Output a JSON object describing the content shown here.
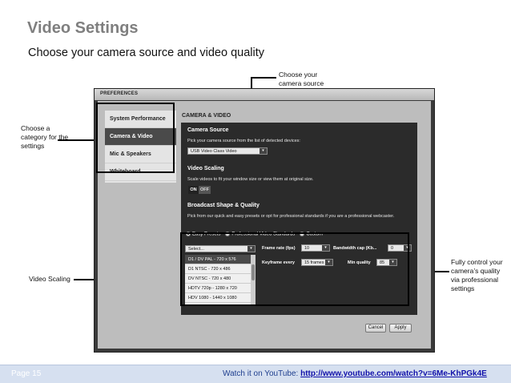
{
  "slide": {
    "title": "Video Settings",
    "subtitle": "Choose your camera source and video quality"
  },
  "callouts": {
    "camera_source": "Choose your camera source",
    "category": "Choose a category for the settings",
    "scaling": "Video Scaling",
    "quality": "Fully control your camera’s quality via professional settings"
  },
  "window": {
    "title": "PREFERENCES",
    "nav": [
      {
        "label": "System Performance",
        "active": false
      },
      {
        "label": "Camera & Video",
        "active": true
      },
      {
        "label": "Mic & Speakers",
        "active": false
      },
      {
        "label": "Whiteboard",
        "active": false
      }
    ],
    "panel_title": "CAMERA & VIDEO",
    "camera_source": {
      "title": "Camera Source",
      "text": "Pick your camera source from the list of detected devices:",
      "selected": "USB Video Class Video"
    },
    "video_scaling": {
      "title": "Video Scaling",
      "text": "Scale videos to fit your window size or view them at original size.",
      "on": "ON",
      "off": "OFF"
    },
    "broadcast": {
      "title": "Broadcast Shape & Quality",
      "text": "Pick from our quick and easy presets or opt for professional standards if you are a professional webcaster.",
      "radios": [
        "Easy Presets",
        "Professional Video Standards",
        "Custom"
      ],
      "select_placeholder": "Select...",
      "presets": [
        "D1 / DV PAL - 720 x 576",
        "D1 NTSC - 720 x 486",
        "DV NTSC - 720 x 480",
        "HDTV 720p - 1280 x 720",
        "HDV 1080 - 1440 x 1080"
      ],
      "frame_rate_label": "Frame rate (fps)",
      "frame_rate_value": "10",
      "bandwidth_label": "Bandwidth cap (Kb...",
      "bandwidth_value": "0",
      "keyframe_label": "Keyframe every",
      "keyframe_value": "15 frames",
      "min_quality_label": "Min quality",
      "min_quality_value": "85"
    },
    "buttons": {
      "cancel": "Cancel",
      "apply": "Apply"
    }
  },
  "footer": {
    "page": "Page 15",
    "watch_text": "Watch it on YouTube: ",
    "link": "http://www.youtube.com/watch?v=6Me-KhPGk4E"
  }
}
